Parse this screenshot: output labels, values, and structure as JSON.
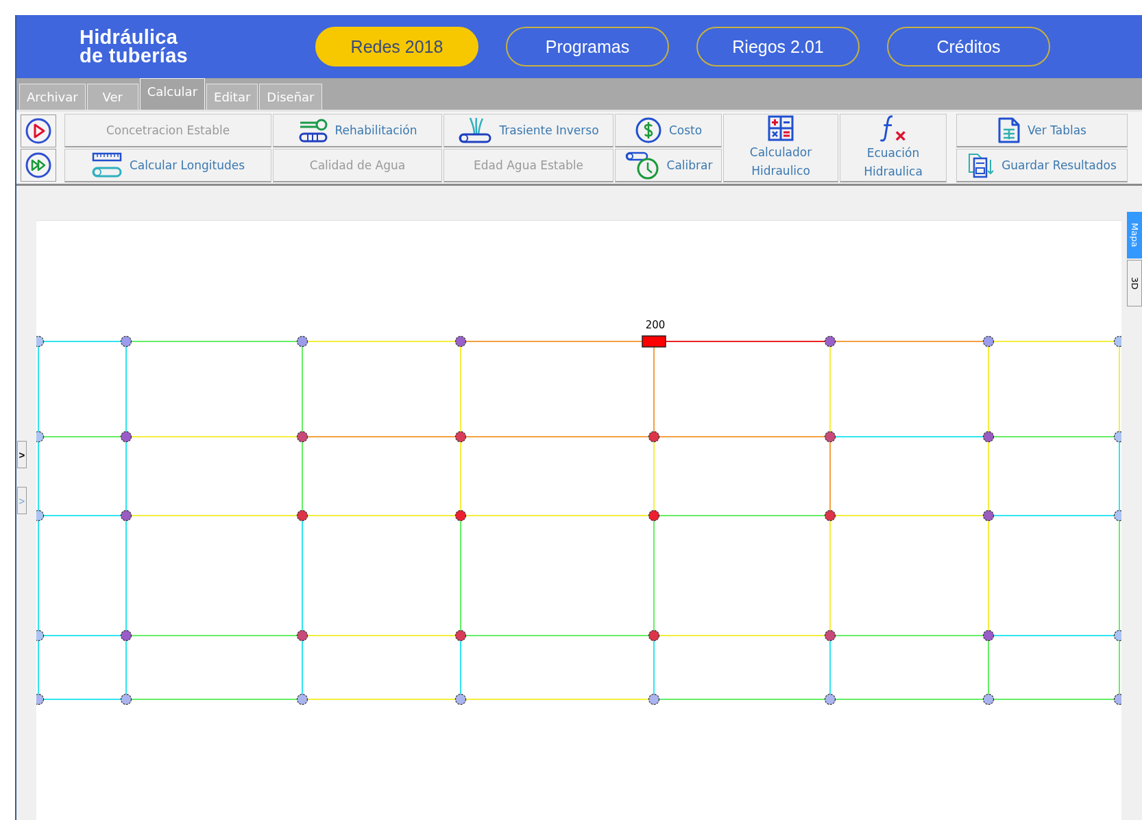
{
  "header": {
    "title_line_1": "Hidráulica",
    "title_line_2": "de tuberías",
    "nav": [
      {
        "label": "Redes 2018",
        "selected": true
      },
      {
        "label": "Programas",
        "selected": false
      },
      {
        "label": "Riegos 2.01",
        "selected": false
      },
      {
        "label": "Créditos",
        "selected": false
      }
    ]
  },
  "tabs": [
    {
      "label": "Archivar",
      "selected": false
    },
    {
      "label": "Ver",
      "selected": false
    },
    {
      "label": "Calcular",
      "selected": true
    },
    {
      "label": "Editar",
      "selected": false
    },
    {
      "label": "Diseñar",
      "selected": false
    }
  ],
  "toolbar": {
    "tools": [
      {
        "label": "Concetracion Estable",
        "disabled": true
      },
      {
        "label": "Rehabilitación",
        "disabled": false
      },
      {
        "label": "Trasiente Inverso",
        "disabled": false
      },
      {
        "label": "Costo",
        "disabled": false
      },
      {
        "label": "Calculador Hidraulico",
        "disabled": false
      },
      {
        "label": "Ecuación Hidraulica",
        "disabled": false
      },
      {
        "label": "Ver Tablas",
        "disabled": false
      },
      {
        "label": "Calcular Longitudes",
        "disabled": false
      },
      {
        "label": "Calidad de Agua",
        "disabled": true
      },
      {
        "label": "Edad Agua Estable",
        "disabled": true
      },
      {
        "label": "Calibrar",
        "disabled": false
      },
      {
        "label": "Guardar Resultados",
        "disabled": false
      }
    ]
  },
  "side_buttons": [
    {
      "label": ">",
      "disabled": false
    },
    {
      "label": ">",
      "disabled": true
    }
  ],
  "view_tabs": [
    {
      "label": "Mapa",
      "selected": true
    },
    {
      "label": "3D",
      "selected": false
    }
  ],
  "network": {
    "nodes": [
      [
        {
          "kind": "junction",
          "color": "#aac4f4"
        },
        {
          "kind": "junction",
          "color": "#9c9cec"
        },
        {
          "kind": "junction",
          "color": "#9c9cec"
        },
        {
          "kind": "junction",
          "color": "#9a62c8"
        },
        {
          "kind": "tank",
          "color": "#ff0000",
          "label": "200"
        },
        {
          "kind": "junction",
          "color": "#9a62c8"
        },
        {
          "kind": "junction",
          "color": "#9c9cec"
        },
        {
          "kind": "junction",
          "color": "#aac4f4"
        }
      ],
      [
        {
          "kind": "junction",
          "color": "#aac4f4"
        },
        {
          "kind": "junction",
          "color": "#9a5cc8"
        },
        {
          "kind": "junction",
          "color": "#c84a78"
        },
        {
          "kind": "junction",
          "color": "#d83c58"
        },
        {
          "kind": "junction",
          "color": "#dc3448"
        },
        {
          "kind": "junction",
          "color": "#c84a78"
        },
        {
          "kind": "junction",
          "color": "#9a5cc0"
        },
        {
          "kind": "junction",
          "color": "#aac4f4"
        }
      ],
      [
        {
          "kind": "junction",
          "color": "#aac4f4"
        },
        {
          "kind": "junction",
          "color": "#9a5cc0"
        },
        {
          "kind": "junction",
          "color": "#dc3448"
        },
        {
          "kind": "junction",
          "color": "#ec2030"
        },
        {
          "kind": "junction",
          "color": "#ec2030"
        },
        {
          "kind": "junction",
          "color": "#dc3448"
        },
        {
          "kind": "junction",
          "color": "#9a5cc0"
        },
        {
          "kind": "junction",
          "color": "#aac4f4"
        }
      ],
      [
        {
          "kind": "junction",
          "color": "#aac4f4"
        },
        {
          "kind": "junction",
          "color": "#9a5cc8"
        },
        {
          "kind": "junction",
          "color": "#c84a78"
        },
        {
          "kind": "junction",
          "color": "#d83c58"
        },
        {
          "kind": "junction",
          "color": "#dc3448"
        },
        {
          "kind": "junction",
          "color": "#c84a78"
        },
        {
          "kind": "junction",
          "color": "#9a5cc8"
        },
        {
          "kind": "junction",
          "color": "#aac4f4"
        }
      ],
      [
        {
          "kind": "junction",
          "color": "#aab4ee"
        },
        {
          "kind": "junction",
          "color": "#aab4ee"
        },
        {
          "kind": "junction",
          "color": "#aab4ee"
        },
        {
          "kind": "junction",
          "color": "#aab4ee"
        },
        {
          "kind": "junction",
          "color": "#aab4ee"
        },
        {
          "kind": "junction",
          "color": "#aab4ee"
        },
        {
          "kind": "junction",
          "color": "#aab4ee"
        },
        {
          "kind": "junction",
          "color": "#aab4ee"
        }
      ]
    ],
    "horizontal_pipes": [
      [
        {
          "color": "#30e4f0"
        },
        {
          "color": "#66ee66"
        },
        {
          "color": "#f4ee40"
        },
        {
          "color": "#f4a040"
        },
        {
          "color": "#ee2222"
        },
        {
          "color": "#f4a040"
        },
        {
          "color": "#f4ee40"
        }
      ],
      [
        {
          "color": "#66ee66"
        },
        {
          "color": "#f4ee40"
        },
        {
          "color": "#f4a040"
        },
        {
          "color": "#f4a040"
        },
        {
          "color": "#f4a040"
        },
        {
          "color": "#30e4f0"
        },
        {
          "color": "#66ee66"
        }
      ],
      [
        {
          "color": "#30e4f0"
        },
        {
          "color": "#f4ee40"
        },
        {
          "color": "#f4ee40"
        },
        {
          "color": "#f4ee40"
        },
        {
          "color": "#66ee66"
        },
        {
          "color": "#f4ee40"
        },
        {
          "color": "#30e4f0"
        }
      ],
      [
        {
          "color": "#30e4f0"
        },
        {
          "color": "#66ee66"
        },
        {
          "color": "#f4ee40"
        },
        {
          "color": "#66ee66"
        },
        {
          "color": "#f4ee40"
        },
        {
          "color": "#66ee66"
        },
        {
          "color": "#30e4f0"
        }
      ],
      [
        {
          "color": "#30e4f0"
        },
        {
          "color": "#66ee66"
        },
        {
          "color": "#f4ee40"
        },
        {
          "color": "#f4ee40"
        },
        {
          "color": "#66ee66"
        },
        {
          "color": "#66ee66"
        },
        {
          "color": "#66ee66"
        }
      ]
    ],
    "vertical_pipes": [
      [
        {
          "color": "#30e4f0"
        },
        {
          "color": "#30e4f0"
        },
        {
          "color": "#30e4f0"
        },
        {
          "color": "#30e4f0"
        }
      ],
      [
        {
          "color": "#30e4f0"
        },
        {
          "color": "#30e4f0"
        },
        {
          "color": "#30e4f0"
        },
        {
          "color": "#30e4f0"
        }
      ],
      [
        {
          "color": "#66ee66"
        },
        {
          "color": "#66ee66"
        },
        {
          "color": "#30e4f0"
        },
        {
          "color": "#30e4f0"
        }
      ],
      [
        {
          "color": "#f4ee40"
        },
        {
          "color": "#f4ee40"
        },
        {
          "color": "#66ee66"
        },
        {
          "color": "#30e4f0"
        }
      ],
      [
        {
          "color": "#f4a040"
        },
        {
          "color": "#f4ee40"
        },
        {
          "color": "#66ee66"
        },
        {
          "color": "#30e4f0"
        }
      ],
      [
        {
          "color": "#f4ee40"
        },
        {
          "color": "#f4a040"
        },
        {
          "color": "#f4ee40"
        },
        {
          "color": "#30e4f0"
        }
      ],
      [
        {
          "color": "#f4ee40"
        },
        {
          "color": "#f4ee40"
        },
        {
          "color": "#f4ee40"
        },
        {
          "color": "#66ee66"
        }
      ],
      [
        {
          "color": "#f4ee40"
        },
        {
          "color": "#30e4f0"
        },
        {
          "color": "#66ee66"
        },
        {
          "color": "#66ee66"
        }
      ]
    ]
  }
}
